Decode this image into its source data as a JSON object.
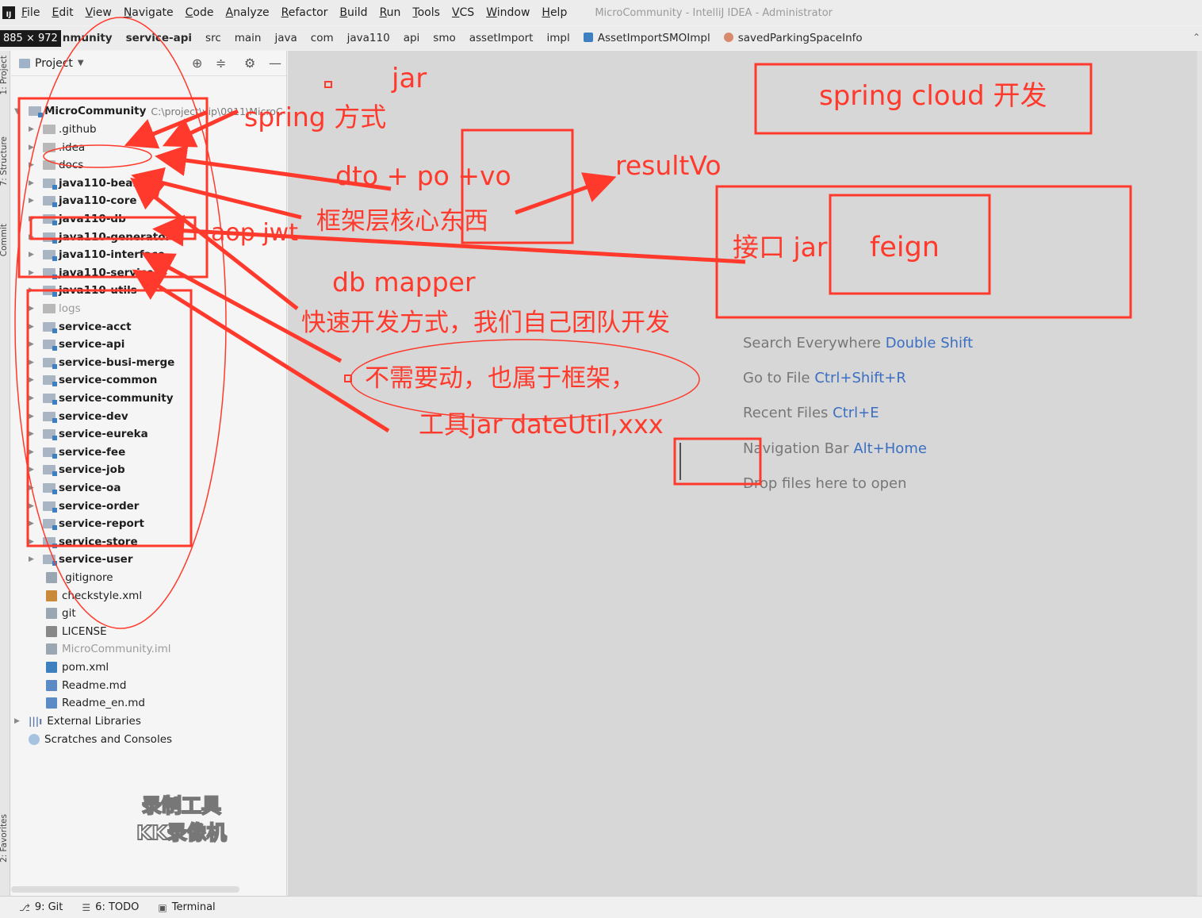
{
  "menubar": {
    "items": [
      "File",
      "Edit",
      "View",
      "Navigate",
      "Code",
      "Analyze",
      "Refactor",
      "Build",
      "Run",
      "Tools",
      "VCS",
      "Window",
      "Help"
    ],
    "window_title": "MicroCommunity - IntelliJ IDEA - Administrator"
  },
  "navbar": {
    "dimension_badge": "885 × 972",
    "crumbs": [
      "nmunity",
      "service-api",
      "src",
      "main",
      "java",
      "com",
      "java110",
      "api",
      "smo",
      "assetImport",
      "impl",
      "AssetImportSMOImpl",
      "savedParkingSpaceInfo"
    ]
  },
  "left_strip": {
    "tabs": [
      "1: Project",
      "7: Structure",
      "Commit",
      "2: Favorites"
    ]
  },
  "project_panel": {
    "title": "Project",
    "root": {
      "name": "MicroCommunity",
      "path": "C:\\project\\vip\\0911\\MicroC"
    },
    "items": [
      {
        "label": ".github",
        "bold": false,
        "dim": false
      },
      {
        "label": ".idea",
        "bold": false,
        "dim": false
      },
      {
        "label": "docs",
        "bold": false,
        "dim": false
      },
      {
        "label": "java110-bean",
        "bold": true,
        "dim": false
      },
      {
        "label": "java110-core",
        "bold": true,
        "dim": false
      },
      {
        "label": "java110-db",
        "bold": true,
        "dim": false
      },
      {
        "label": "java110-generator",
        "bold": true,
        "dim": false
      },
      {
        "label": "java110-interface",
        "bold": true,
        "dim": false
      },
      {
        "label": "java110-service",
        "bold": true,
        "dim": false
      },
      {
        "label": "java110-utils",
        "bold": true,
        "dim": false
      },
      {
        "label": "logs",
        "bold": false,
        "dim": true
      },
      {
        "label": "service-acct",
        "bold": true,
        "dim": false
      },
      {
        "label": "service-api",
        "bold": true,
        "dim": false
      },
      {
        "label": "service-busi-merge",
        "bold": true,
        "dim": false
      },
      {
        "label": "service-common",
        "bold": true,
        "dim": false
      },
      {
        "label": "service-community",
        "bold": true,
        "dim": false
      },
      {
        "label": "service-dev",
        "bold": true,
        "dim": false
      },
      {
        "label": "service-eureka",
        "bold": true,
        "dim": false
      },
      {
        "label": "service-fee",
        "bold": true,
        "dim": false
      },
      {
        "label": "service-job",
        "bold": true,
        "dim": false
      },
      {
        "label": "service-oa",
        "bold": true,
        "dim": false
      },
      {
        "label": "service-order",
        "bold": true,
        "dim": false
      },
      {
        "label": "service-report",
        "bold": true,
        "dim": false
      },
      {
        "label": "service-store",
        "bold": true,
        "dim": false
      },
      {
        "label": "service-user",
        "bold": true,
        "dim": false
      }
    ],
    "files": [
      ".gitignore",
      "checkstyle.xml",
      "git",
      "LICENSE",
      "MicroCommunity.iml",
      "pom.xml",
      "Readme.md",
      "Readme_en.md"
    ],
    "external_libraries": "External Libraries",
    "scratches": "Scratches and Consoles",
    "watermark": [
      "录制工具",
      "KK录像机"
    ]
  },
  "editor": {
    "hints": [
      {
        "text": "Search Everywhere ",
        "key": "Double Shift"
      },
      {
        "text": "Go to File ",
        "key": "Ctrl+Shift+R"
      },
      {
        "text": "Recent Files ",
        "key": "Ctrl+E"
      },
      {
        "text": "Navigation Bar ",
        "key": "Alt+Home"
      },
      {
        "text": "Drop files here to open",
        "key": ""
      }
    ]
  },
  "statusbar": {
    "tabs": [
      {
        "icon": "git-icon",
        "label": "9: Git"
      },
      {
        "icon": "todo-icon",
        "label": "6: TODO"
      },
      {
        "icon": "terminal-icon",
        "label": "Terminal"
      }
    ]
  },
  "annotations": {
    "accent_color": "#ff3a2c",
    "texts": {
      "jar": "jar",
      "spring": "spring 方式",
      "dto": "dto + po +vo",
      "resultvo": "resultVo",
      "framework_core": "框架层核心东西",
      "aop": "aop  jwt",
      "db_mapper": "db mapper",
      "fast_dev": "快速开发方式，我们自己团队开发",
      "no_touch": "不需要动，也属于框架，",
      "tools_jar": "工具jar dateUtil,xxx",
      "spring_cloud": "spring cloud 开发",
      "interface_jar": "接口 jar",
      "feign": "feign"
    }
  }
}
